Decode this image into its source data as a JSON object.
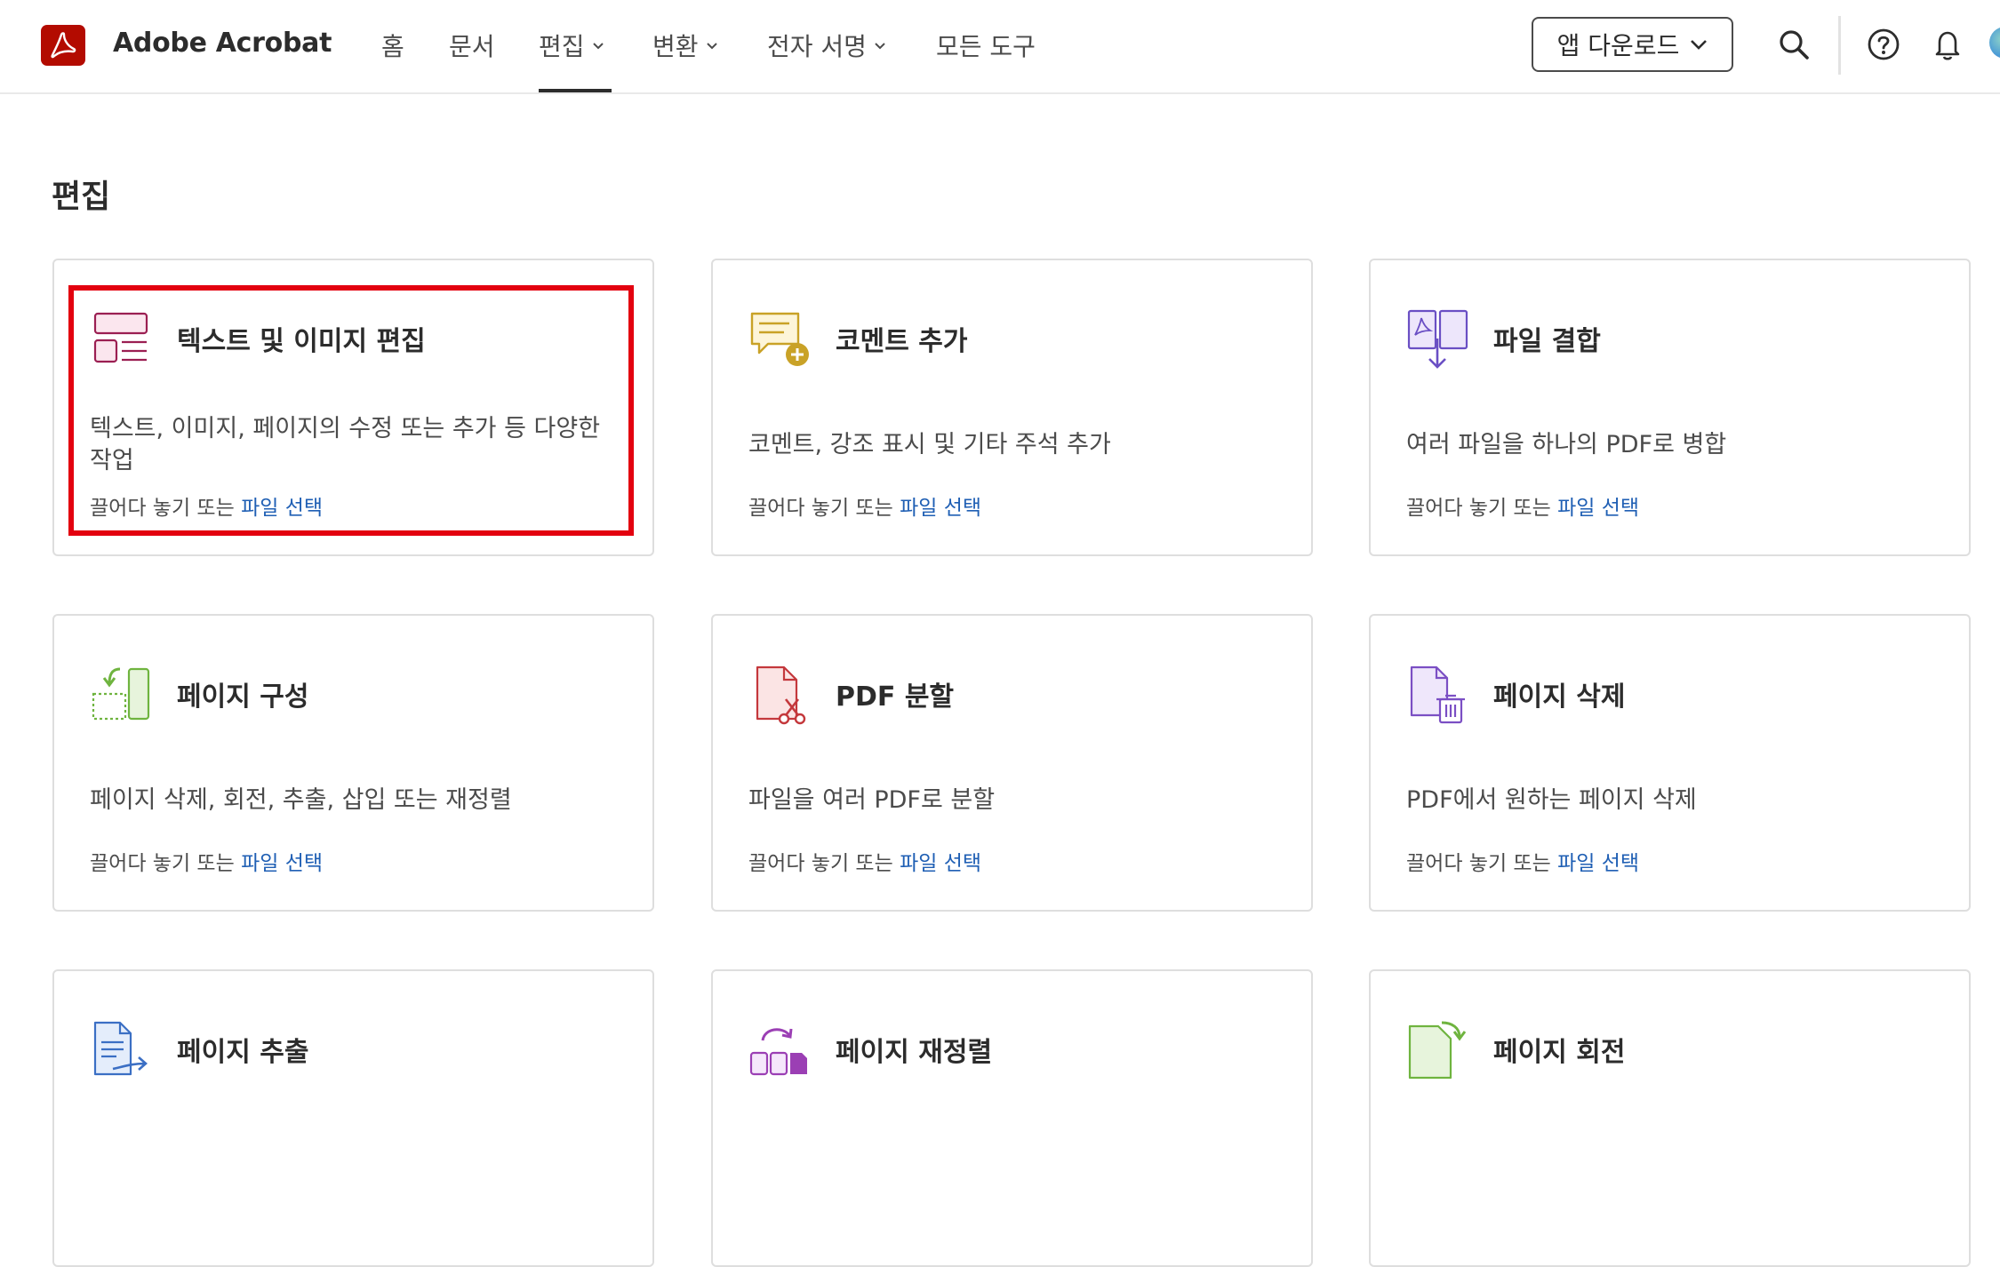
{
  "header": {
    "app_name": "Adobe Acrobat",
    "nav": [
      {
        "label": "홈",
        "has_dropdown": false
      },
      {
        "label": "문서",
        "has_dropdown": false
      },
      {
        "label": "편집",
        "has_dropdown": true,
        "active": true
      },
      {
        "label": "변환",
        "has_dropdown": true
      },
      {
        "label": "전자 서명",
        "has_dropdown": true
      },
      {
        "label": "모든 도구",
        "has_dropdown": false
      }
    ],
    "download_button": "앱 다운로드",
    "icons": [
      "search-icon",
      "help-icon",
      "notification-bell-icon",
      "avatar"
    ]
  },
  "section": {
    "title": "편집"
  },
  "drop_text": "끌어다 놓기 또는",
  "file_select_link": "파일 선택",
  "cards": [
    {
      "title": "텍스트 및 이미지 편집",
      "desc": "텍스트, 이미지, 페이지의 수정 또는 추가 등 다양한 작업",
      "icon": "edit-text-image-icon",
      "highlighted": true
    },
    {
      "title": "코멘트 추가",
      "desc": "코멘트, 강조 표시 및 기타 주석 추가",
      "icon": "add-comment-icon"
    },
    {
      "title": "파일 결합",
      "desc": "여러 파일을 하나의 PDF로 병합",
      "icon": "combine-files-icon"
    },
    {
      "title": "페이지 구성",
      "desc": "페이지 삭제, 회전, 추출, 삽입 또는 재정렬",
      "icon": "organize-pages-icon"
    },
    {
      "title": "PDF 분할",
      "desc": "파일을 여러 PDF로 분할",
      "icon": "split-pdf-icon"
    },
    {
      "title": "페이지 삭제",
      "desc": "PDF에서 원하는 페이지 삭제",
      "icon": "delete-pages-icon"
    },
    {
      "title": "페이지 추출",
      "desc": "",
      "icon": "extract-pages-icon"
    },
    {
      "title": "페이지 재정렬",
      "desc": "",
      "icon": "reorder-pages-icon"
    },
    {
      "title": "페이지 회전",
      "desc": "",
      "icon": "rotate-pages-icon"
    }
  ],
  "colors": {
    "brand_red": "#b30b00",
    "link_blue": "#1f5fb4",
    "highlight_red": "#e3000f"
  }
}
